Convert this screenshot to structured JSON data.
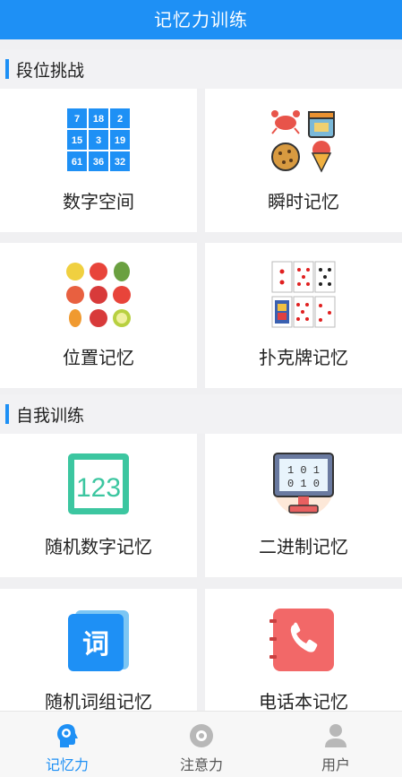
{
  "header": {
    "title": "记忆力训练"
  },
  "sections": [
    {
      "label": "段位挑战"
    },
    {
      "label": "自我训练"
    }
  ],
  "cards": {
    "number_space": {
      "label": "数字空间",
      "grid": [
        "7",
        "18",
        "2",
        "15",
        "3",
        "19",
        "61",
        "36",
        "32"
      ]
    },
    "instant_memory": {
      "label": "瞬时记忆"
    },
    "position_memory": {
      "label": "位置记忆"
    },
    "poker_memory": {
      "label": "扑克牌记忆"
    },
    "random_number": {
      "label": "随机数字记忆",
      "icon_text": "123"
    },
    "binary_memory": {
      "label": "二进制记忆",
      "icon_text_top": "1 0 1",
      "icon_text_bottom": "0 1 0"
    },
    "random_word": {
      "label": "随机词组记忆",
      "icon_text": "词"
    },
    "phone_book": {
      "label": "电话本记忆"
    }
  },
  "nav": [
    {
      "label": "记忆力",
      "icon": "brain-gear-icon",
      "active": true
    },
    {
      "label": "注意力",
      "icon": "target-icon",
      "active": false
    },
    {
      "label": "用户",
      "icon": "user-icon",
      "active": false
    }
  ],
  "colors": {
    "accent": "#1e90f5",
    "grid_blue": "#1e90f5",
    "teal": "#3cc6a0",
    "phone_red": "#f26868"
  }
}
